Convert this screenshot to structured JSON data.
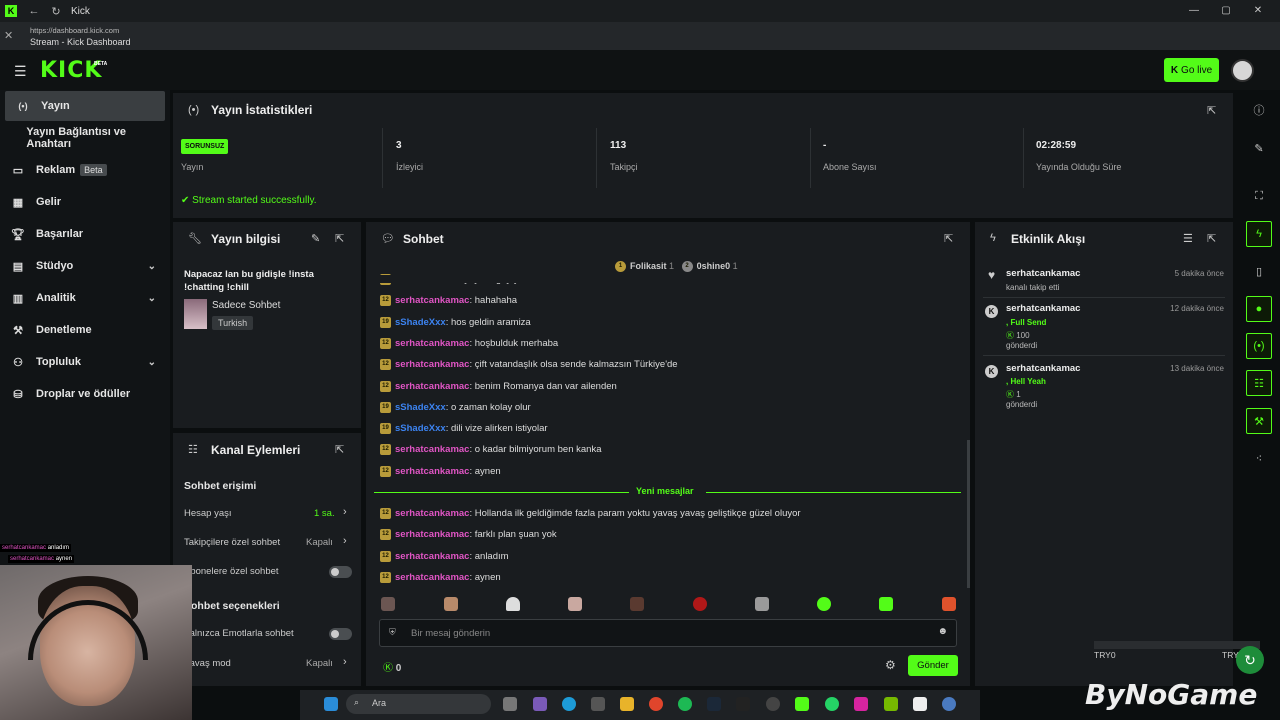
{
  "window": {
    "title": "Kick",
    "controls": [
      "—",
      "▢",
      "✕"
    ]
  },
  "url_bar": {
    "url": "https://dashboard.kick.com",
    "page_title": "Stream - Kick Dashboard"
  },
  "header": {
    "logo": "KICK",
    "logo_badge": "BETA",
    "go_live_label": "Go live"
  },
  "sidebar": {
    "items": [
      {
        "label": "Yayın",
        "icon": "broadcast-icon"
      },
      {
        "label": "Yayın Bağlantısı ve Anahtarı"
      },
      {
        "label": "Reklam",
        "badge": "Beta",
        "icon": "ads-icon"
      },
      {
        "label": "Gelir",
        "icon": "revenue-icon"
      },
      {
        "label": "Başarılar",
        "icon": "trophy-icon"
      },
      {
        "label": "Stüdyo",
        "icon": "studio-icon"
      },
      {
        "label": "Analitik",
        "icon": "analytics-icon"
      },
      {
        "label": "Denetleme",
        "icon": "moderation-icon"
      },
      {
        "label": "Topluluk",
        "icon": "community-icon"
      },
      {
        "label": "Droplar ve ödüller",
        "icon": "drops-icon"
      }
    ]
  },
  "stats": {
    "title": "Yayın İstatistikleri",
    "status_badge": "SORUNSUZ",
    "status_label": "Yayın",
    "viewers_value": "3",
    "viewers_label": "İzleyici",
    "followers_value": "113",
    "followers_label": "Takipçi",
    "subs_value": "-",
    "subs_label": "Abone Sayısı",
    "uptime_value": "02:28:59",
    "uptime_label": "Yayında Olduğu Süre",
    "success_message": "Stream started successfully."
  },
  "stream_info": {
    "title": "Yayın bilgisi",
    "stream_title": "Napacaz lan bu gidişle !insta !chatting !chill",
    "category": "Sadece Sohbet",
    "language": "Turkish"
  },
  "channel_actions": {
    "title": "Kanal Eylemleri",
    "section1": "Sohbet erişimi",
    "account_age_label": "Hesap yaşı",
    "account_age_value": "1 sa.",
    "followers_only_label": "Takipçilere özel sohbet",
    "followers_only_value": "Kapalı",
    "subs_only_label": "Abonelere özel sohbet",
    "section2": "Sohbet seçenekleri",
    "emotes_only_label": "Yalnızca Emotlarla sohbet",
    "slow_mode_label": "Yavaş mod",
    "slow_mode_value": "Kapalı"
  },
  "chat": {
    "title": "Sohbet",
    "top_chatters": [
      {
        "rank": "1",
        "name": "Folikasit",
        "count": "1"
      },
      {
        "rank": "2",
        "name": "0shine0",
        "count": "1"
      }
    ],
    "messages": [
      {
        "badge": "19",
        "user": "sShadeXxx",
        "text": ": bu yayinci gay ya",
        "color": "blue"
      },
      {
        "badge": "12",
        "user": "serhatcankamac",
        "text": ": hahahaha",
        "color": "pink"
      },
      {
        "badge": "19",
        "user": "sShadeXxx",
        "text": ": hos geldin aramiza",
        "color": "blue"
      },
      {
        "badge": "12",
        "user": "serhatcankamac",
        "text": ": hoşbulduk merhaba",
        "color": "pink"
      },
      {
        "badge": "12",
        "user": "serhatcankamac",
        "text": ": çift vatandaşlık olsa sende kalmazsın Türkiye'de",
        "color": "pink"
      },
      {
        "badge": "12",
        "user": "serhatcankamac",
        "text": ": benim Romanya dan var ailenden",
        "color": "pink"
      },
      {
        "badge": "19",
        "user": "sShadeXxx",
        "text": ": o zaman kolay olur",
        "color": "blue"
      },
      {
        "badge": "19",
        "user": "sShadeXxx",
        "text": ": dili vize alirken istiyolar",
        "color": "blue"
      },
      {
        "badge": "12",
        "user": "serhatcankamac",
        "text": ": o kadar bilmiyorum ben kanka",
        "color": "pink"
      },
      {
        "badge": "12",
        "user": "serhatcankamac",
        "text": ": aynen",
        "color": "pink"
      }
    ],
    "new_messages_label": "Yeni mesajlar",
    "new_messages": [
      {
        "badge": "12",
        "user": "serhatcankamac",
        "text": ": Hollanda ilk geldiğimde fazla param yoktu yavaş yavaş geliştikçe güzel oluyor",
        "color": "pink"
      },
      {
        "badge": "12",
        "user": "serhatcankamac",
        "text": ": farklı plan şuan yok",
        "color": "pink"
      },
      {
        "badge": "12",
        "user": "serhatcankamac",
        "text": ": anladım",
        "color": "pink"
      },
      {
        "badge": "12",
        "user": "serhatcankamac",
        "text": ": aynen",
        "color": "pink"
      }
    ],
    "input_placeholder": "Bir mesaj gönderin",
    "points": "0",
    "send_label": "Gönder"
  },
  "activity": {
    "title": "Etkinlik Akışı",
    "events": [
      {
        "user": "serhatcankamac",
        "time": "5 dakika önce",
        "line1": "kanalı takip etti"
      },
      {
        "user": "serhatcankamac",
        "time": "12 dakika önce",
        "reward": ", Full Send",
        "amount": "100",
        "line2": "gönderdi"
      },
      {
        "user": "serhatcankamac",
        "time": "13 dakika önce",
        "reward": ", Hell Yeah",
        "amount": "1",
        "line2": "gönderdi"
      }
    ]
  },
  "overlay": {
    "cam_chat": [
      {
        "user": "serhatcankamac",
        "text": "anladım"
      },
      {
        "user": "serhatcankamac",
        "text": "aynen"
      }
    ],
    "taskbar_search": "Ara",
    "watermark": "ByNoGame",
    "ticker_left": "TRY0",
    "ticker_right": "TRY0"
  },
  "colors": {
    "accent": "#53fc18",
    "panel": "#191c1f",
    "bg": "#0b0e0f",
    "user_pink": "#e055c4",
    "user_blue": "#3c83f0"
  }
}
